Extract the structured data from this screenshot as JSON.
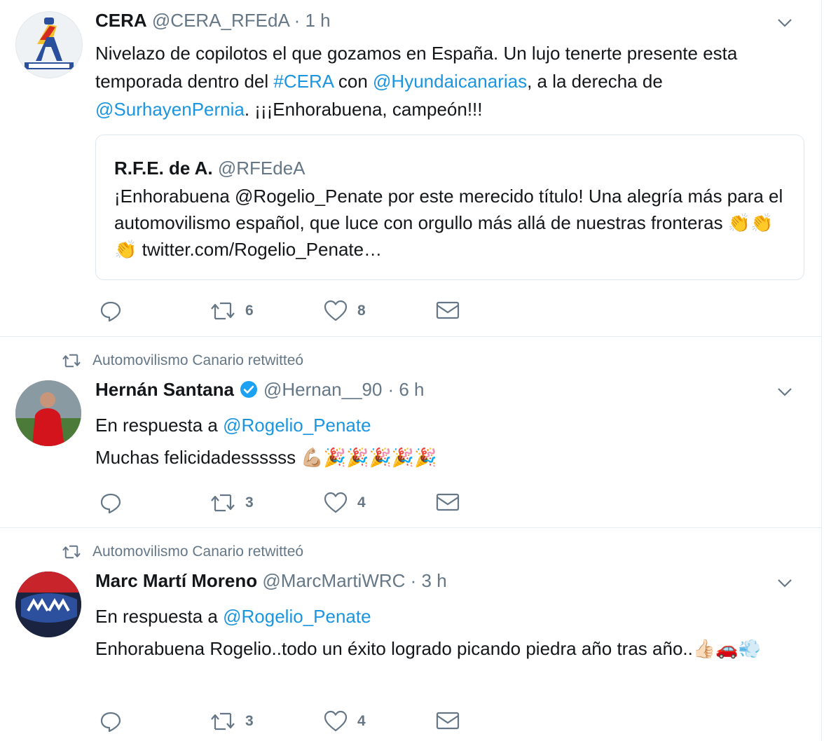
{
  "tweets": [
    {
      "name": "CERA",
      "handle": "@CERA_RFEdA",
      "time": "· 1 h",
      "text_1": "Nivelazo de copilotos el que gozamos en España. Un lujo tenerte presente esta temporada dentro del ",
      "hashtag": "#CERA",
      "text_2": " con ",
      "mention_1": "@Hyundaicanarias",
      "text_3": ", a la derecha de ",
      "mention_2": "@SurhayenPernia",
      "text_4": ". ¡¡¡Enhorabuena, campeón!!!",
      "quote": {
        "name": "R.F.E. de A.",
        "handle": "@RFEdeA",
        "text": "¡Enhorabuena @Rogelio_Penate por este merecido título! Una alegría más para el automovilismo español, que luce con orgullo más allá de nuestras fronteras ",
        "emoji": "👏👏👏",
        "link": " twitter.com/Rogelio_Penate…"
      },
      "retweets": "6",
      "likes": "8"
    },
    {
      "retweeted_by": "Automovilismo Canario retwitteó",
      "name": "Hernán Santana",
      "handle": "@Hernan__90",
      "time": "· 6 h",
      "reply_prefix": "En respuesta a ",
      "reply_to": "@Rogelio_Penate",
      "text": "Muchas felicidadessssss ",
      "emoji": "💪🏼🎉🎉🎉🎉🎉",
      "retweets": "3",
      "likes": "4"
    },
    {
      "retweeted_by": "Automovilismo Canario retwitteó",
      "name": "Marc Martí Moreno",
      "handle": "@MarcMartiWRC",
      "time": "· 3 h",
      "reply_prefix": "En respuesta a ",
      "reply_to": "@Rogelio_Penate",
      "text": "Enhorabuena Rogelio..todo un éxito logrado picando piedra año tras año..",
      "emoji": "👍🏻🚗💨",
      "retweets": "3",
      "likes": "4"
    }
  ],
  "icons": [
    "reply-icon",
    "retweet-icon",
    "like-icon",
    "message-icon",
    "chevron-down-icon",
    "verified-icon"
  ],
  "colors": {
    "link": "#1b95e0",
    "muted": "#657786",
    "text": "#14171a",
    "verified": "#1da1f2"
  }
}
